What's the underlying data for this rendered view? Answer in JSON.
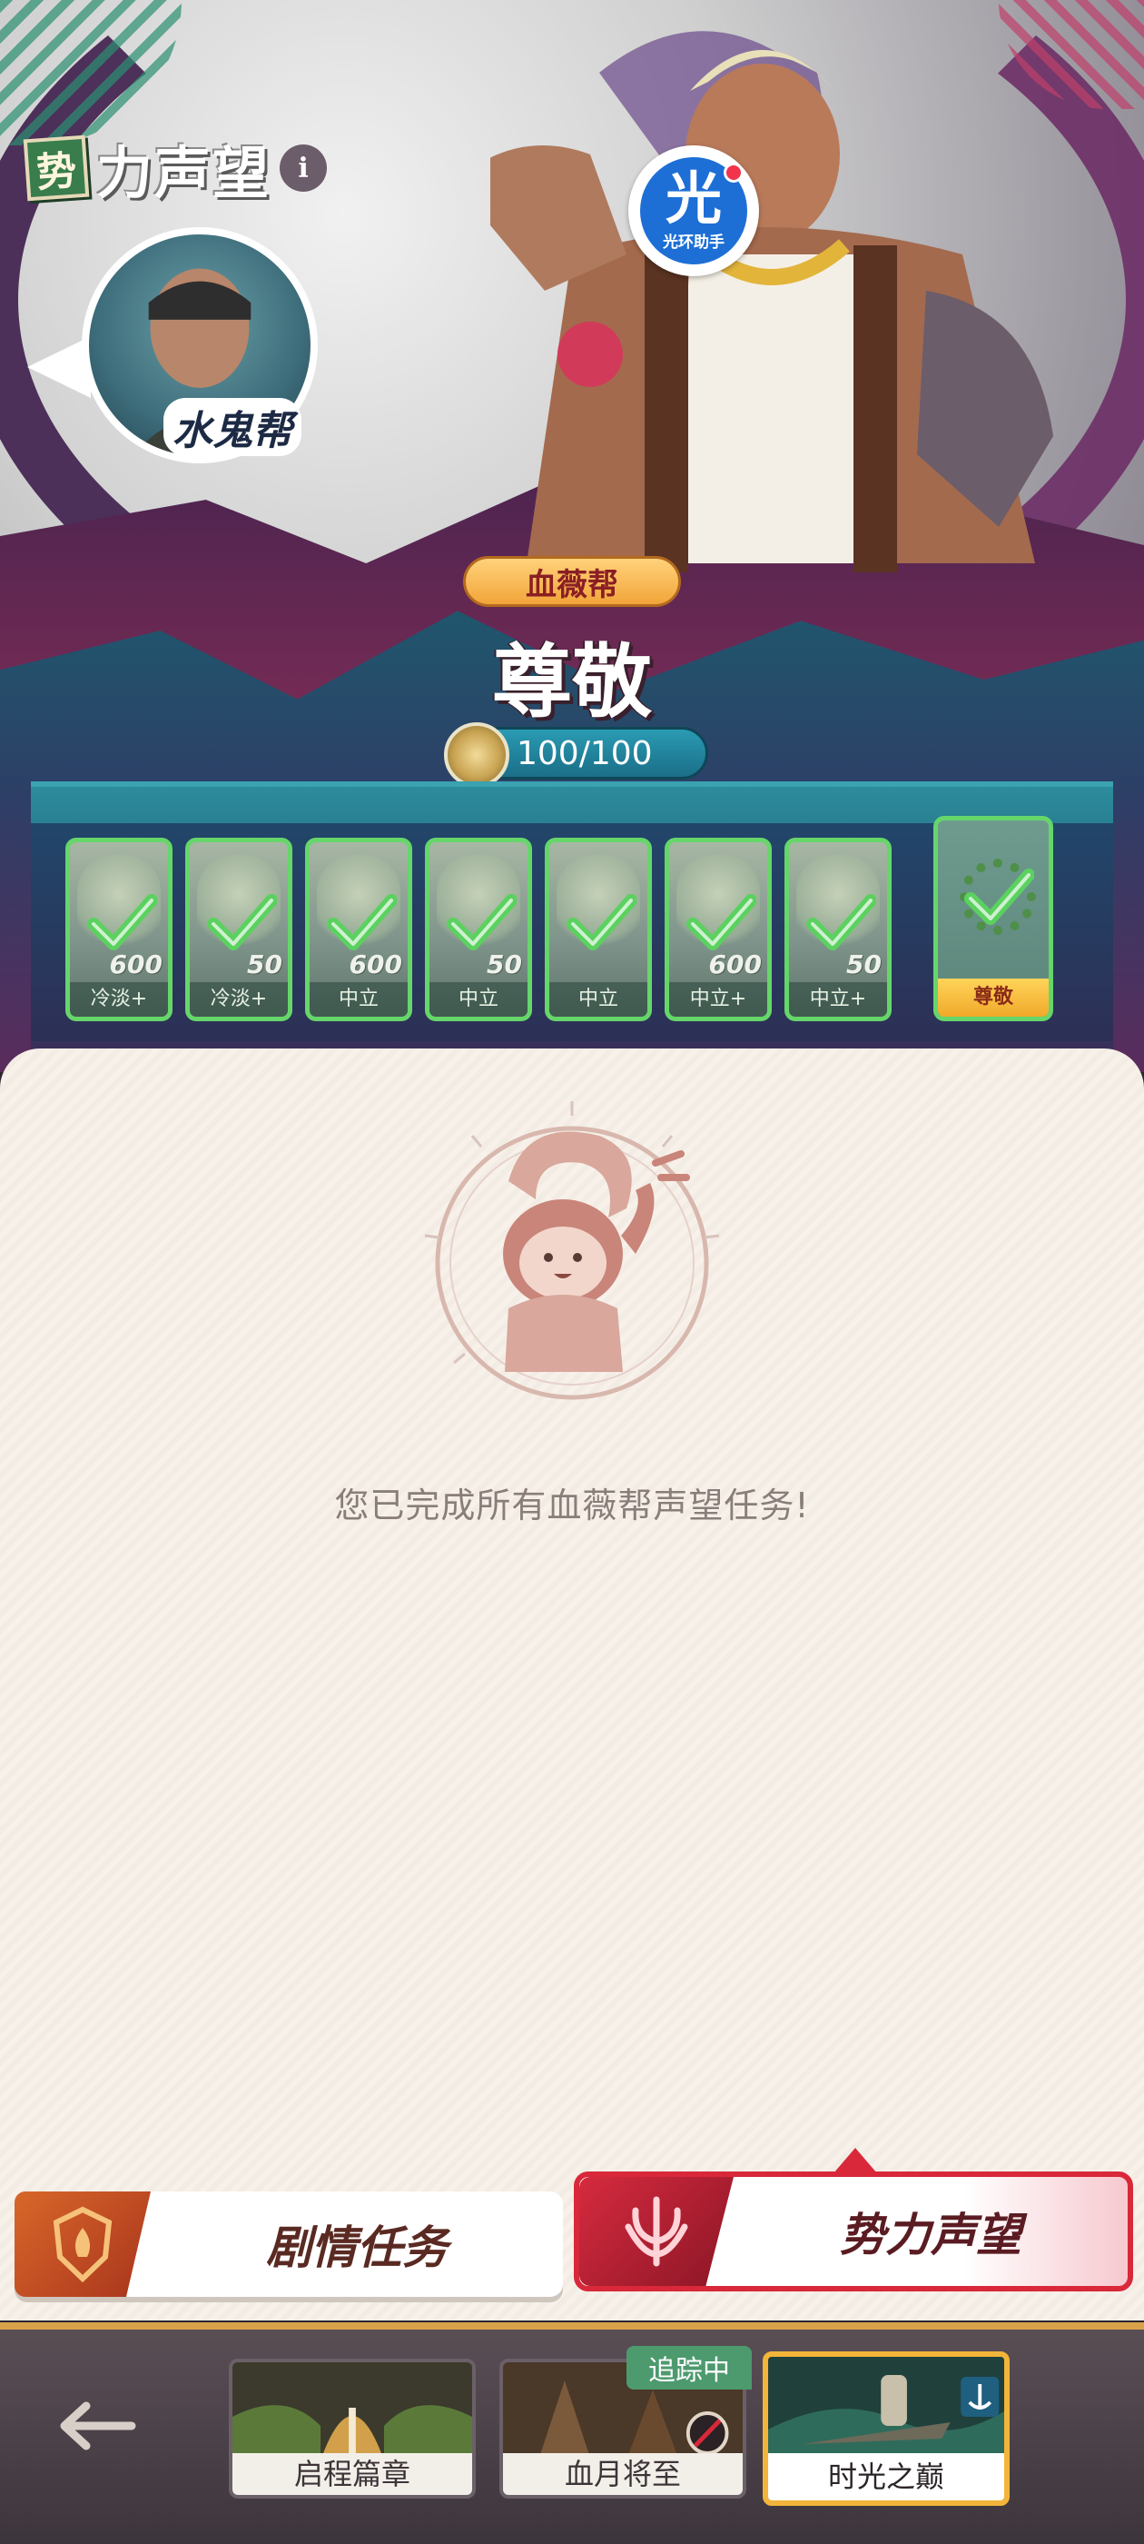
{
  "header": {
    "title_badge": "势",
    "title_rest": "力声望",
    "info_glyph": "i"
  },
  "faction_avatar": {
    "name": "水鬼帮"
  },
  "watermark": {
    "glyph": "光",
    "text": "光环助手"
  },
  "faction": {
    "name": "血薇帮",
    "rank": "尊敬",
    "progress": "100/100",
    "progress_value": 100,
    "progress_max": 100
  },
  "milestones": [
    {
      "label": "冷淡+",
      "amount": "600",
      "completed": true
    },
    {
      "label": "冷淡+",
      "amount": "50",
      "completed": true
    },
    {
      "label": "中立",
      "amount": "600",
      "completed": true
    },
    {
      "label": "中立",
      "amount": "50",
      "completed": true
    },
    {
      "label": "中立",
      "amount": "",
      "completed": true
    },
    {
      "label": "中立+",
      "amount": "600",
      "completed": true
    },
    {
      "label": "中立+",
      "amount": "50",
      "completed": true
    },
    {
      "label": "尊敬",
      "amount": "",
      "completed": true
    }
  ],
  "main": {
    "completion_text": "您已完成所有血薇帮声望任务!"
  },
  "tabs": [
    {
      "label": "剧情任务",
      "active": false
    },
    {
      "label": "势力声望",
      "active": true
    }
  ],
  "chapters": [
    {
      "name": "启程篇章",
      "active": false
    },
    {
      "name": "血月将至",
      "active": false,
      "badge": "追踪中"
    },
    {
      "name": "时光之巅",
      "active": true
    }
  ],
  "colors": {
    "accent_red": "#d8283a",
    "check_green": "#66d66a",
    "gold": "#f2b53a"
  }
}
